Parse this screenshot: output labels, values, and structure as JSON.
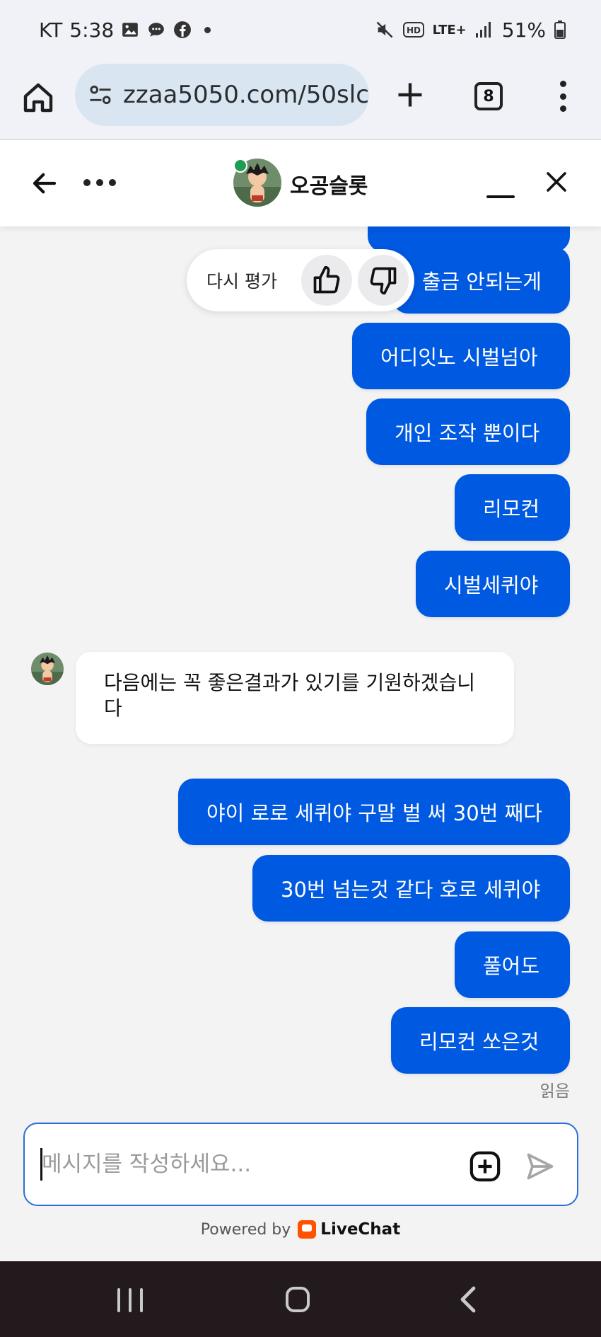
{
  "status_bar": {
    "carrier": "KT",
    "time": "5:38",
    "network": "LTE+",
    "battery": "51%"
  },
  "browser": {
    "url": "zzaa5050.com/50slc",
    "tab_count": "8"
  },
  "chat_header": {
    "title": "오공슬롯",
    "online_color": "#1f9d55"
  },
  "messages": [
    {
      "from": "user",
      "text": "출금 안되는게"
    },
    {
      "from": "user",
      "text": "어디잇노 시벌넘아"
    },
    {
      "from": "user",
      "text": "개인 조작 뿐이다"
    },
    {
      "from": "user",
      "text": "리모컨"
    },
    {
      "from": "user",
      "text": "시벌세퀴야"
    },
    {
      "from": "agent",
      "text": "다음에는 꼭 좋은결과가 있기를 기원하겠습니다"
    },
    {
      "from": "user",
      "text": "야이 로로 세퀴야 구말 벌 써 30번 째다"
    },
    {
      "from": "user",
      "text": "30번 넘는것 같다 호로 세퀴야"
    },
    {
      "from": "user",
      "text": "풀어도"
    },
    {
      "from": "user",
      "text": "리모컨 쏘은것"
    }
  ],
  "rating": {
    "label": "다시 평가"
  },
  "read_status": "읽음",
  "composer": {
    "placeholder": "메시지를 작성하세요..."
  },
  "footer": {
    "powered_by": "Powered by",
    "brand": "LiveChat"
  },
  "colors": {
    "user_bubble": "#0059e1",
    "brand_orange": "#ff5100"
  }
}
